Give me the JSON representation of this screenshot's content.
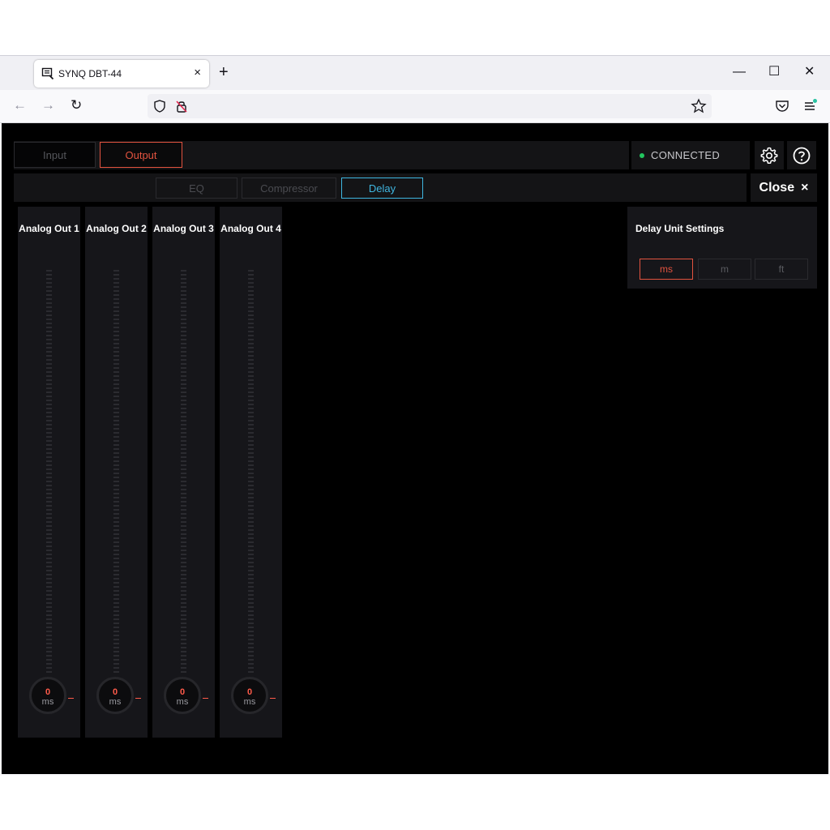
{
  "browser": {
    "tab_title": "SYNQ DBT-44",
    "tab_close": "×",
    "new_tab": "+",
    "window_controls": {
      "minimize": "—",
      "maximize": "☐",
      "close": "✕"
    },
    "nav": {
      "back": "←",
      "forward": "→",
      "reload": "↻"
    }
  },
  "app": {
    "mode_tabs": [
      {
        "label": "Input",
        "active": false
      },
      {
        "label": "Output",
        "active": true
      }
    ],
    "status": {
      "text": "CONNECTED",
      "color": "#22c55e"
    },
    "sub_tabs": [
      {
        "label": "EQ",
        "active": false
      },
      {
        "label": "Compressor",
        "active": false
      },
      {
        "label": "Delay",
        "active": true
      }
    ],
    "close_label": "Close",
    "close_icon": "×",
    "channels": [
      {
        "name": "Analog Out 1",
        "value": "0",
        "unit": "ms"
      },
      {
        "name": "Analog Out 2",
        "value": "0",
        "unit": "ms"
      },
      {
        "name": "Analog Out 3",
        "value": "0",
        "unit": "ms"
      },
      {
        "name": "Analog Out 4",
        "value": "0",
        "unit": "ms"
      }
    ],
    "delay_settings": {
      "title": "Delay Unit Settings",
      "units": [
        {
          "label": "ms",
          "active": true
        },
        {
          "label": "m",
          "active": false
        },
        {
          "label": "ft",
          "active": false
        }
      ]
    },
    "colors": {
      "accent_red": "#e2533f",
      "accent_blue": "#3fb6e0",
      "background": "#000000"
    }
  }
}
